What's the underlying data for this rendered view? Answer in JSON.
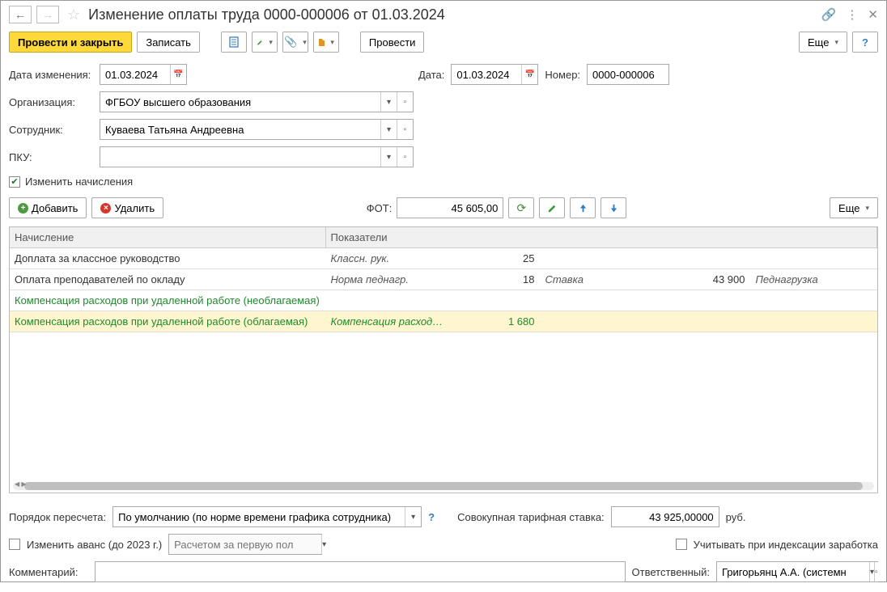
{
  "title": "Изменение оплаты труда 0000-000006 от 01.03.2024",
  "toolbar": {
    "post_close": "Провести и закрыть",
    "save": "Записать",
    "post": "Провести",
    "more": "Еще"
  },
  "fields": {
    "change_date_label": "Дата изменения:",
    "change_date": "01.03.2024",
    "date_label": "Дата:",
    "date": "01.03.2024",
    "number_label": "Номер:",
    "number": "0000-000006",
    "org_label": "Организация:",
    "org": "ФГБОУ высшего образования",
    "employee_label": "Сотрудник:",
    "employee": "Куваева Татьяна Андреевна",
    "pku_label": "ПКУ:",
    "pku": "",
    "change_accruals_label": "Изменить начисления"
  },
  "table_toolbar": {
    "add": "Добавить",
    "delete": "Удалить",
    "fot_label": "ФОТ:",
    "fot_value": "45 605,00",
    "more": "Еще"
  },
  "table": {
    "col_accrual": "Начисление",
    "col_indicators": "Показатели",
    "rows": [
      {
        "accrual": "Доплата за классное руководство",
        "ind1": "Классн. рук.",
        "val1": "25",
        "ind2": "",
        "val2": "",
        "ind3": "",
        "green": false,
        "selected": false
      },
      {
        "accrual": "Оплата преподавателей по окладу",
        "ind1": "Норма педнагр.",
        "val1": "18",
        "ind2": "Ставка",
        "val2": "43 900",
        "ind3": "Педнагрузка",
        "green": false,
        "selected": false
      },
      {
        "accrual": "Компенсация расходов при удаленной работе (необлагаемая)",
        "ind1": "",
        "val1": "",
        "ind2": "",
        "val2": "",
        "ind3": "",
        "green": true,
        "selected": false
      },
      {
        "accrual": "Компенсация расходов при удаленной работе (облагаемая)",
        "ind1": "Компенсация расход…",
        "val1": "1 680",
        "ind2": "",
        "val2": "",
        "ind3": "",
        "green": true,
        "selected": true
      }
    ]
  },
  "footer": {
    "recalc_label": "Порядок пересчета:",
    "recalc_value": "По умолчанию (по норме времени графика сотрудника)",
    "tariff_label": "Совокупная тарифная ставка:",
    "tariff_value": "43 925,00000",
    "tariff_unit": "руб.",
    "change_advance_label": "Изменить аванс (до 2023 г.)",
    "advance_calc_placeholder": "Расчетом за первую пол",
    "consider_index_label": "Учитывать при индексации заработка",
    "comment_label": "Комментарий:",
    "comment": "",
    "responsible_label": "Ответственный:",
    "responsible": "Григорьянц А.А. (системн"
  }
}
